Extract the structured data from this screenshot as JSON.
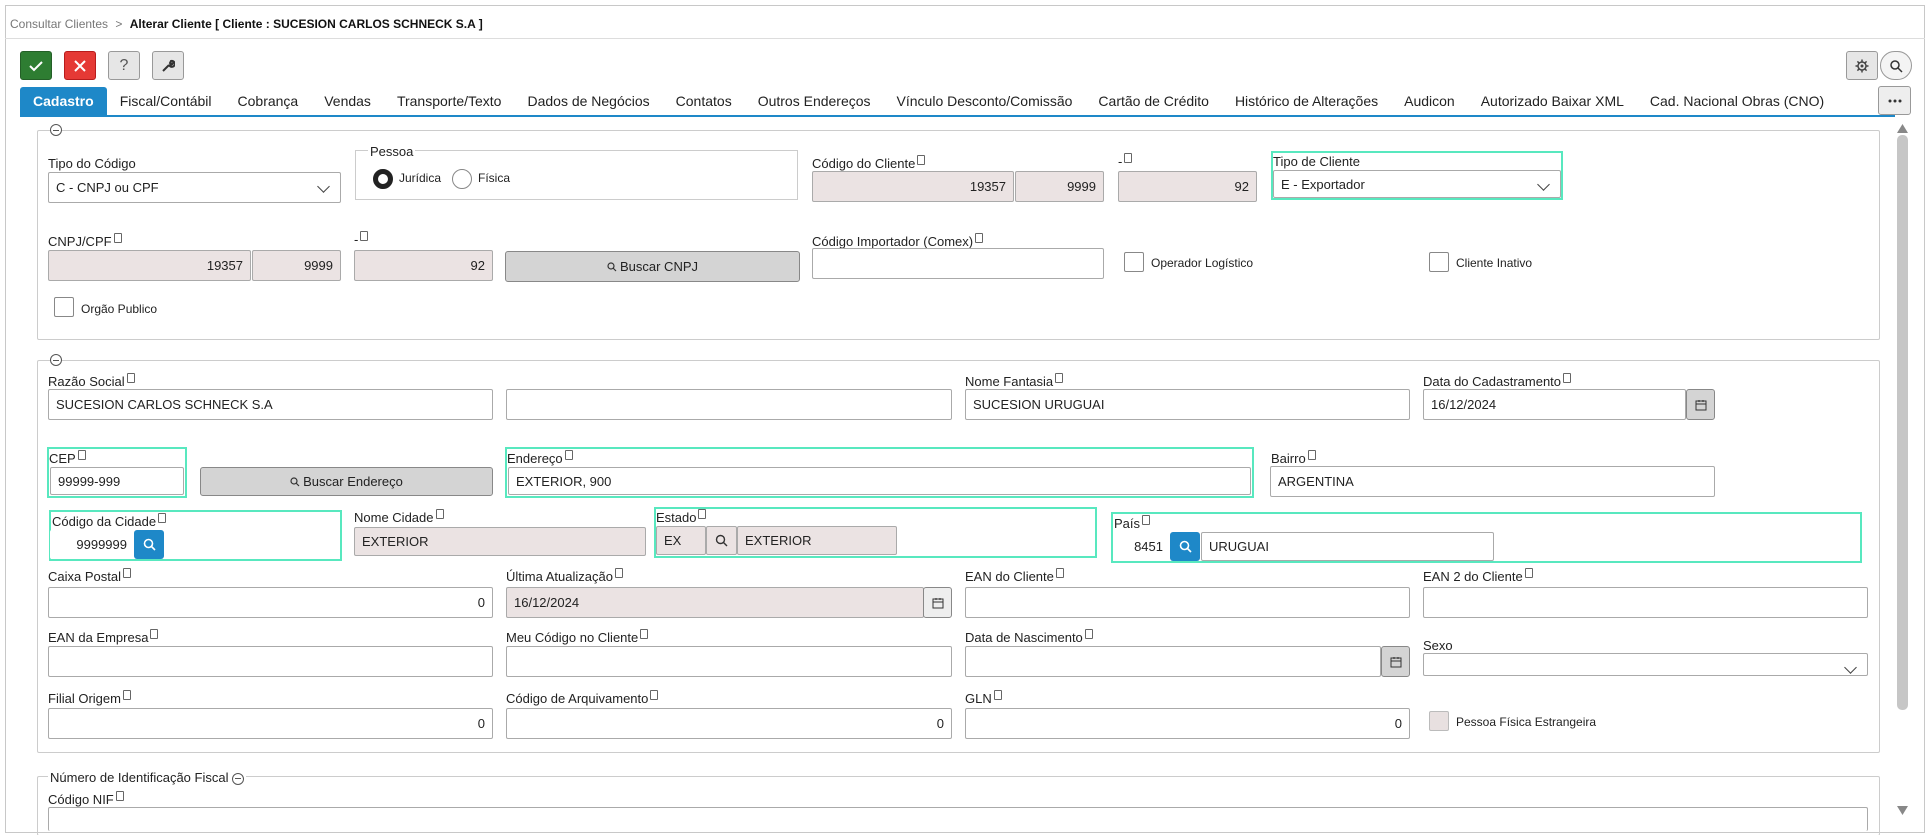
{
  "breadcrumb": {
    "parent": "Consultar Clientes",
    "separator": ">",
    "current": "Alterar Cliente [ Cliente : SUCESION CARLOS SCHNECK S.A ]"
  },
  "toolbar": {
    "help_label": "?"
  },
  "tabs": [
    "Cadastro",
    "Fiscal/Contábil",
    "Cobrança",
    "Vendas",
    "Transporte/Texto",
    "Dados de Negócios",
    "Contatos",
    "Outros Endereços",
    "Vínculo Desconto/Comissão",
    "Cartão de Crédito",
    "Histórico de Alterações",
    "Audicon",
    "Autorizado Baixar XML",
    "Cad. Nacional Obras (CNO)"
  ],
  "section1": {
    "tipo_codigo": {
      "label": "Tipo do Código",
      "value": "C - CNPJ ou CPF"
    },
    "pessoa": {
      "legend": "Pessoa",
      "options": [
        "Jurídica",
        "Física"
      ],
      "selected": "Jurídica"
    },
    "codigo_cliente": {
      "label": "Código do Cliente",
      "value1": "19357",
      "value2": "9999"
    },
    "dash1": {
      "label": "-",
      "value": "92"
    },
    "tipo_cliente": {
      "label": "Tipo de Cliente",
      "value": "E - Exportador"
    },
    "cnpj": {
      "label": "CNPJ/CPF",
      "value1": "19357",
      "value2": "9999"
    },
    "dash2": {
      "label": "-",
      "value": "92"
    },
    "buscar_cnpj": "Buscar CNPJ",
    "codigo_importador": {
      "label": "Código Importador (Comex)",
      "value": ""
    },
    "operador_logistico": "Operador Logístico",
    "cliente_inativo": "Cliente Inativo",
    "orgao_publico": "Orgão Publico"
  },
  "section2": {
    "razao_social": {
      "label": "Razão Social",
      "value": "SUCESION CARLOS SCHNECK S.A",
      "value2": ""
    },
    "nome_fantasia": {
      "label": "Nome Fantasia",
      "value": "SUCESION URUGUAI"
    },
    "data_cadastramento": {
      "label": "Data do Cadastramento",
      "value": "16/12/2024"
    },
    "cep": {
      "label": "CEP",
      "value": "99999-999"
    },
    "buscar_endereco": "Buscar Endereço",
    "endereco": {
      "label": "Endereço",
      "value": "EXTERIOR, 900"
    },
    "bairro": {
      "label": "Bairro",
      "value": "ARGENTINA"
    },
    "codigo_cidade": {
      "label": "Código da Cidade",
      "value": "9999999"
    },
    "nome_cidade": {
      "label": "Nome Cidade",
      "value": "EXTERIOR"
    },
    "estado": {
      "label": "Estado",
      "code": "EX",
      "name": "EXTERIOR"
    },
    "pais": {
      "label": "País",
      "code": "8451",
      "name": "URUGUAI"
    },
    "caixa_postal": {
      "label": "Caixa Postal",
      "value": "0"
    },
    "ultima_atualizacao": {
      "label": "Última Atualização",
      "value": "16/12/2024"
    },
    "ean_cliente": {
      "label": "EAN do Cliente",
      "value": ""
    },
    "ean2_cliente": {
      "label": "EAN 2 do Cliente",
      "value": ""
    },
    "ean_empresa": {
      "label": "EAN da Empresa",
      "value": ""
    },
    "meu_codigo": {
      "label": "Meu Código no Cliente",
      "value": ""
    },
    "data_nascimento": {
      "label": "Data de Nascimento",
      "value": ""
    },
    "sexo": {
      "label": "Sexo",
      "value": ""
    },
    "filial_origem": {
      "label": "Filial Origem",
      "value": "0"
    },
    "codigo_arquivamento": {
      "label": "Código de Arquivamento",
      "value": "0"
    },
    "gln": {
      "label": "GLN",
      "value": "0"
    },
    "pessoa_fisica_estrangeira": "Pessoa Física Estrangeira"
  },
  "section3": {
    "legend": "Número de Identificação Fiscal",
    "codigo_nif": {
      "label": "Código NIF"
    }
  },
  "colors": {
    "accent": "#1e88c8",
    "highlight": "#58e8bf",
    "save": "#2e7d32",
    "cancel": "#e53935"
  }
}
